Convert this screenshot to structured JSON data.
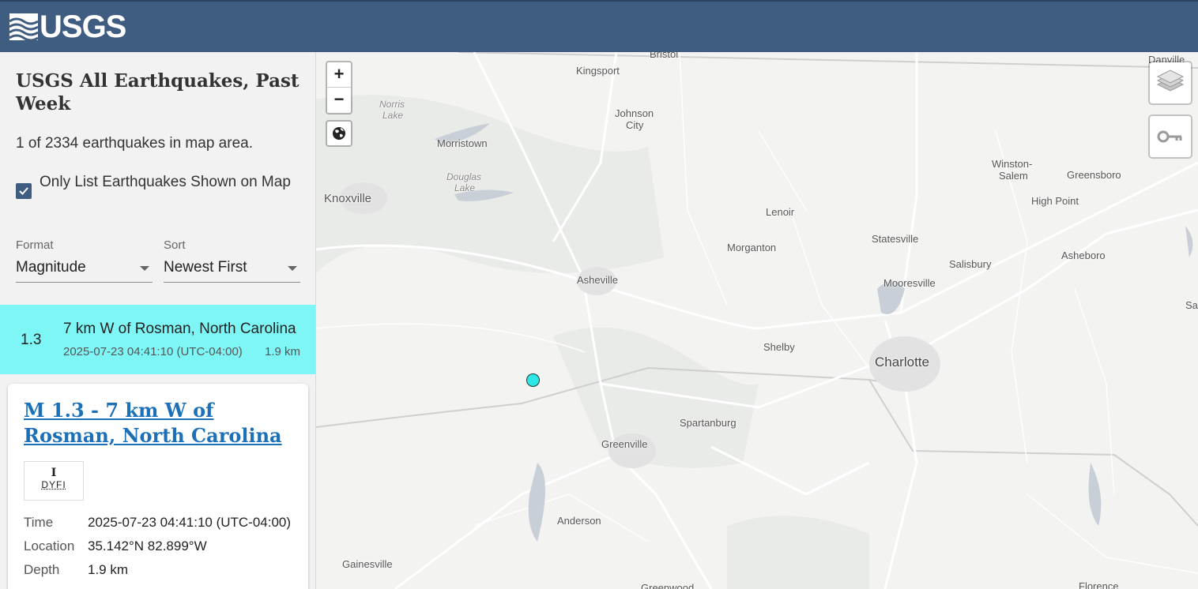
{
  "header": {
    "logo_text": "USGS"
  },
  "sidebar": {
    "title": "USGS All Earthquakes, Past Week",
    "count_text": "1 of 2334 earthquakes in map area.",
    "only_list_label": "Only List Earthquakes Shown on Map",
    "only_list_checked": true,
    "format": {
      "label": "Format",
      "value": "Magnitude"
    },
    "sort": {
      "label": "Sort",
      "value": "Newest First"
    }
  },
  "list": [
    {
      "mag": "1.3",
      "place": "7 km W of Rosman, North Carolina",
      "time": "2025-07-23 04:41:10 (UTC-04:00)",
      "depth": "1.9 km",
      "highlight_color": "#7ff6f6"
    }
  ],
  "detail": {
    "title": "M 1.3 - 7 km W of Rosman, North Carolina",
    "dyfi_value": "I",
    "dyfi_label": "DYFI",
    "fields": [
      {
        "key": "Time",
        "value": "2025-07-23 04:41:10 (UTC-04:00)"
      },
      {
        "key": "Location",
        "value": "35.142°N 82.899°W"
      },
      {
        "key": "Depth",
        "value": "1.9 km"
      }
    ]
  },
  "map": {
    "controls": {
      "zoom_in": "+",
      "zoom_out": "−"
    },
    "icons": [
      "globe-icon",
      "layers-icon",
      "legend-key-icon"
    ],
    "place_labels": {
      "bristol": "Bristol",
      "kingsport": "Kingsport",
      "johnson_city_1": "Johnson",
      "johnson_city_2": "City",
      "norris_lake_1": "Norris",
      "norris_lake_2": "Lake",
      "morristown": "Morristown",
      "douglas_lake_1": "Douglas",
      "douglas_lake_2": "Lake",
      "knoxville": "Knoxville",
      "lenoir": "Lenoir",
      "winston_salem_1": "Winston-",
      "winston_salem_2": "Salem",
      "greensboro": "Greensboro",
      "high_point": "High Point",
      "statesville": "Statesville",
      "morganton": "Morganton",
      "asheboro": "Asheboro",
      "salisbury": "Salisbury",
      "asheville": "Asheville",
      "mooresville": "Mooresville",
      "shelby": "Shelby",
      "charlotte": "Charlotte",
      "spartanburg": "Spartanburg",
      "greenville": "Greenville",
      "anderson": "Anderson",
      "gainesville": "Gainesville",
      "greenwood": "Greenwood",
      "florence": "Florence",
      "danville": "Danville",
      "sanford": "Sar"
    },
    "event_marker_color": "#2ee6e6"
  }
}
